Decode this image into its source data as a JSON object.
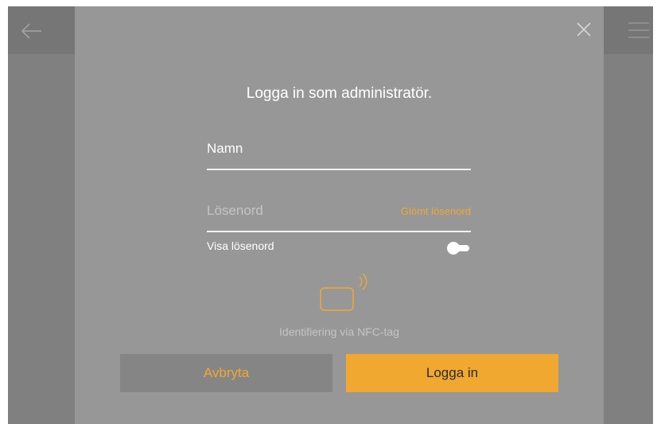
{
  "colors": {
    "accent": "#f0a830",
    "background": "#808080",
    "dialog": "#979797",
    "text": "#ffffff",
    "muted": "#c4c4c4"
  },
  "topbar": {
    "back_icon": "arrow-left-icon",
    "menu_icon": "hamburger-menu-icon"
  },
  "dialog": {
    "close_icon": "close-icon",
    "title": "Logga in som administratör.",
    "name_field": {
      "placeholder": "Namn",
      "value": ""
    },
    "password_field": {
      "placeholder": "Lösenord",
      "value": ""
    },
    "forgot_password": "Glömt lösenord",
    "show_password": {
      "label": "Visa lösenord",
      "enabled": false
    },
    "nfc": {
      "icon": "nfc-card-icon",
      "caption": "Identifiering via NFC-tag"
    },
    "cancel_label": "Avbryta",
    "login_label": "Logga in"
  }
}
